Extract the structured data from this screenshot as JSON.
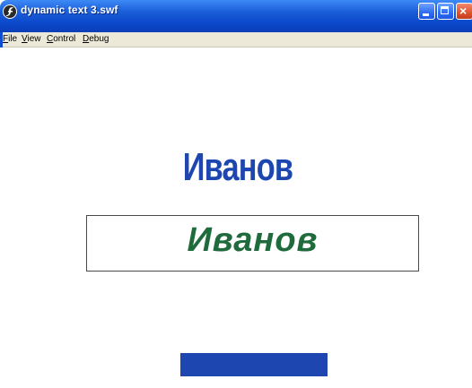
{
  "window": {
    "title": "dynamic text 3.swf",
    "controls": {
      "close_glyph": "×"
    }
  },
  "menu": {
    "items": [
      {
        "underline": "F",
        "rest": "ile"
      },
      {
        "underline": "V",
        "rest": "iew"
      },
      {
        "underline": "C",
        "rest": "ontrol"
      },
      {
        "underline": "D",
        "rest": "ebug"
      }
    ]
  },
  "content": {
    "big_name": "Иванов",
    "box_name": "Иванов"
  },
  "colors": {
    "title_blue": "#0c49cc",
    "text_blue": "#1e46b0",
    "text_green": "#1f6b3c",
    "bar_blue": "#1e46b0"
  },
  "icons": {
    "app_icon": "flash-player-icon",
    "minimize": "minimize-icon",
    "maximize": "maximize-icon",
    "close": "close-icon"
  }
}
